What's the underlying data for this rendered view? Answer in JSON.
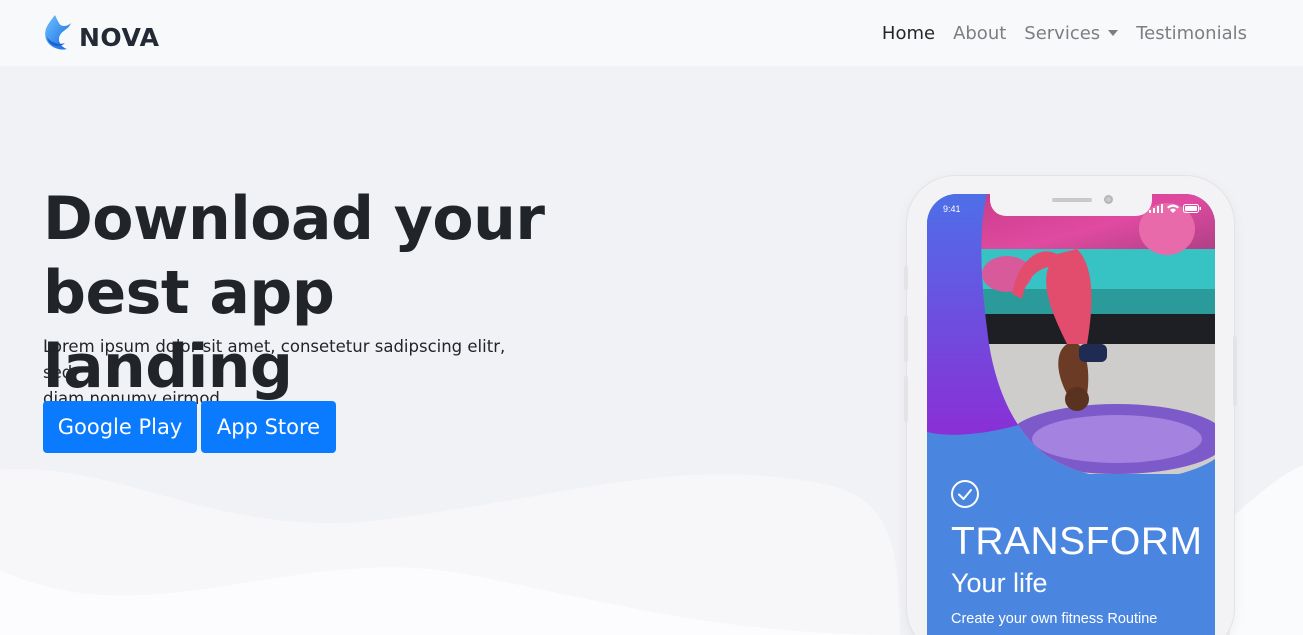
{
  "brand": {
    "name": "NOVA"
  },
  "nav": {
    "items": [
      {
        "label": "Home",
        "active": true
      },
      {
        "label": "About"
      },
      {
        "label": "Services",
        "dropdown": true
      },
      {
        "label": "Testimonials"
      }
    ]
  },
  "hero": {
    "title_line1": "Download your",
    "title_line2": "best app landing",
    "subtitle_line1": "Lorem ipsum dolor sit amet, consetetur sadipscing elitr, sed",
    "subtitle_line2": "diam nonumy eirmod.",
    "google_play_label": "Google Play",
    "app_store_label": "App Store"
  },
  "phone": {
    "status_time": "9:41",
    "headline": "TRANSFORM",
    "subheadline": "Your life",
    "caption": "Create your own fitness Routine"
  },
  "colors": {
    "primary": "#0a7bff",
    "background": "#f1f2f6",
    "navbar": "#f8f9fb",
    "phone_blue": "#4a86e0",
    "phone_purple": "#7b3ed8"
  },
  "icons": [
    "nova-flame-logo-icon",
    "caret-down-icon",
    "check-circle-icon",
    "signal-icon",
    "wifi-icon",
    "battery-icon"
  ]
}
